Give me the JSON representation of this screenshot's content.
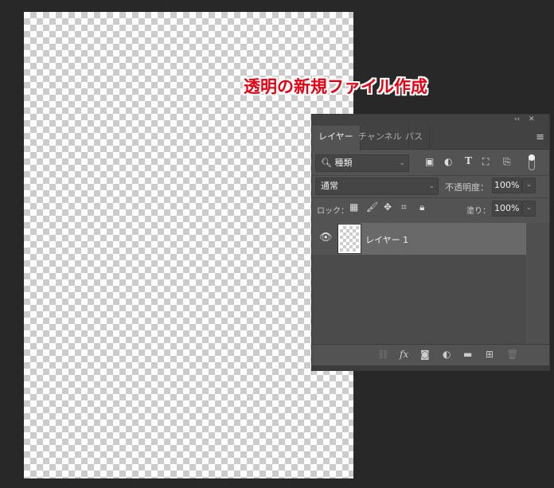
{
  "caption": "透明の新規ファイル作成",
  "panel": {
    "collapse": "‹‹",
    "close": "✕",
    "tabs": [
      "レイヤー",
      "チャンネル",
      "パス"
    ],
    "filter": {
      "label": "種類"
    },
    "blend_mode": "通常",
    "opacity_label": "不透明度：",
    "opacity": "100%",
    "lock_label": "ロック：",
    "fill_label": "塗り：",
    "fill": "100%",
    "layers": [
      {
        "name": "レイヤー 1",
        "visible": true
      }
    ]
  }
}
